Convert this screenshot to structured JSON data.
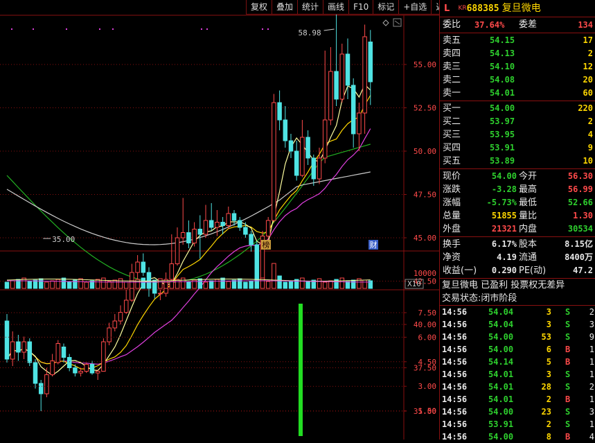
{
  "toolbar": {
    "items": [
      "复权",
      "叠加",
      "统计",
      "画线",
      "F10",
      "标记",
      "+自选",
      "返回"
    ]
  },
  "stock": {
    "marker": "L",
    "badge": "KR",
    "code": "688385",
    "name": "复旦微电"
  },
  "price_axis": [
    "55.00",
    "52.50",
    "50.00",
    "47.50",
    "45.00",
    "42.50",
    "40.00",
    "37.50",
    "35.00"
  ],
  "high_annotation": "58.98",
  "low_annotation": "35.00",
  "chart_tags": {
    "bang": "榜",
    "cai": "财"
  },
  "volume_axis": {
    "label": "10000",
    "multiplier": "X10"
  },
  "lower_axis": [
    "7.50",
    "6.00",
    "4.50",
    "3.00",
    "1.50"
  ],
  "order_book": {
    "weibi_label": "委比",
    "weibi_value": "37.64%",
    "weicha_label": "委差",
    "weicha_value": "134",
    "sell": [
      {
        "label": "卖五",
        "price": "54.15",
        "vol": "17"
      },
      {
        "label": "卖四",
        "price": "54.13",
        "vol": "2"
      },
      {
        "label": "卖三",
        "price": "54.10",
        "vol": "12"
      },
      {
        "label": "卖二",
        "price": "54.08",
        "vol": "20"
      },
      {
        "label": "卖一",
        "price": "54.01",
        "vol": "60"
      }
    ],
    "buy": [
      {
        "label": "买一",
        "price": "54.00",
        "vol": "220"
      },
      {
        "label": "买二",
        "price": "53.97",
        "vol": "2"
      },
      {
        "label": "买三",
        "price": "53.95",
        "vol": "4"
      },
      {
        "label": "买四",
        "price": "53.91",
        "vol": "9"
      },
      {
        "label": "买五",
        "price": "53.89",
        "vol": "10"
      }
    ]
  },
  "quote": [
    {
      "l1": "现价",
      "v1": "54.00",
      "c1": "green",
      "l2": "今开",
      "v2": "56.30",
      "c2": "red"
    },
    {
      "l1": "涨跌",
      "v1": "-3.28",
      "c1": "green",
      "l2": "最高",
      "v2": "56.99",
      "c2": "red"
    },
    {
      "l1": "涨幅",
      "v1": "-5.73%",
      "c1": "green",
      "l2": "最低",
      "v2": "52.66",
      "c2": "green"
    },
    {
      "l1": "总量",
      "v1": "51855",
      "c1": "yellow",
      "l2": "量比",
      "v2": "1.30",
      "c2": "red"
    },
    {
      "l1": "外盘",
      "v1": "21321",
      "c1": "red",
      "l2": "内盘",
      "v2": "30534",
      "c2": "green"
    }
  ],
  "fundamentals": [
    {
      "l1": "换手",
      "v1": "6.17%",
      "l2": "股本",
      "v2": "8.15亿"
    },
    {
      "l1": "净资",
      "v1": "4.19",
      "l2": "流通",
      "v2": "8400万"
    },
    {
      "l1": "收益(一)",
      "v1": "0.290",
      "l2": "PE(动)",
      "v2": "47.2"
    }
  ],
  "info": {
    "line1": "复旦微电 已盈利 投票权无差异",
    "line2": "交易状态:闭市阶段"
  },
  "ticks": [
    {
      "time": "14:56",
      "price": "54.04",
      "vol": "3",
      "side": "S",
      "n": "2"
    },
    {
      "time": "14:56",
      "price": "54.04",
      "vol": "3",
      "side": "S",
      "n": "3"
    },
    {
      "time": "14:56",
      "price": "54.00",
      "vol": "53",
      "side": "S",
      "n": "9"
    },
    {
      "time": "14:56",
      "price": "54.00",
      "vol": "6",
      "side": "B",
      "n": "1"
    },
    {
      "time": "14:56",
      "price": "54.14",
      "vol": "5",
      "side": "B",
      "n": "1"
    },
    {
      "time": "14:56",
      "price": "54.01",
      "vol": "3",
      "side": "S",
      "n": "1"
    },
    {
      "time": "14:56",
      "price": "54.01",
      "vol": "28",
      "side": "S",
      "n": "2"
    },
    {
      "time": "14:56",
      "price": "54.01",
      "vol": "2",
      "side": "B",
      "n": "1"
    },
    {
      "time": "14:56",
      "price": "54.00",
      "vol": "23",
      "side": "S",
      "n": "3"
    },
    {
      "time": "14:56",
      "price": "53.91",
      "vol": "2",
      "side": "S",
      "n": "1"
    },
    {
      "time": "14:56",
      "price": "54.00",
      "vol": "8",
      "side": "B",
      "n": "4"
    }
  ],
  "colors": {
    "up": "#ff4a4a",
    "down": "#4fe3e3",
    "grid": "#8a1010",
    "ma5": "#ffffa0",
    "ma10": "#ffd700",
    "ma20": "#e040e0",
    "ma60": "#cccccc",
    "ma120": "#22b022",
    "bar": "#22dd22"
  },
  "chart_data": {
    "type": "candlestick",
    "candles": [
      [
        40.2,
        38.0,
        40.6,
        37.8
      ],
      [
        38.0,
        39.0,
        39.6,
        37.6
      ],
      [
        39.0,
        38.4,
        39.4,
        37.9
      ],
      [
        38.4,
        39.0,
        39.3,
        38.0
      ],
      [
        39.0,
        37.8,
        39.2,
        37.6
      ],
      [
        37.8,
        36.6,
        38.0,
        36.3
      ],
      [
        36.6,
        36.0,
        36.8,
        35.0
      ],
      [
        36.0,
        37.1,
        37.5,
        35.8
      ],
      [
        37.1,
        37.9,
        38.3,
        37.0
      ],
      [
        37.8,
        38.9,
        39.1,
        37.7
      ],
      [
        38.7,
        38.1,
        38.9,
        37.8
      ],
      [
        38.1,
        37.5,
        38.3,
        37.3
      ],
      [
        37.5,
        37.2,
        37.7,
        37.0
      ],
      [
        37.2,
        37.3,
        37.5,
        37.0
      ],
      [
        37.3,
        37.7,
        37.8,
        37.2
      ],
      [
        37.7,
        37.2,
        37.9,
        37.1
      ],
      [
        37.2,
        37.3,
        37.4,
        36.8
      ],
      [
        37.3,
        39.0,
        39.2,
        37.3
      ],
      [
        39.0,
        39.8,
        40.1,
        38.8
      ],
      [
        39.8,
        40.2,
        40.6,
        39.6
      ],
      [
        40.2,
        40.7,
        41.1,
        40.0
      ],
      [
        40.7,
        41.4,
        42.0,
        40.6
      ],
      [
        41.4,
        43.0,
        43.5,
        41.3
      ],
      [
        43.0,
        43.6,
        44.0,
        42.3
      ],
      [
        43.6,
        43.0,
        44.1,
        42.8
      ],
      [
        43.0,
        42.1,
        43.3,
        41.6
      ],
      [
        42.1,
        41.8,
        42.3,
        41.5
      ],
      [
        41.8,
        41.8,
        42.0,
        41.4
      ],
      [
        41.8,
        42.6,
        43.0,
        41.6
      ],
      [
        42.6,
        43.5,
        45.2,
        42.4
      ],
      [
        43.5,
        45.0,
        45.6,
        43.4
      ],
      [
        45.0,
        45.3,
        47.3,
        44.6
      ],
      [
        45.3,
        44.7,
        46.0,
        44.4
      ],
      [
        44.7,
        45.5,
        45.9,
        44.5
      ],
      [
        45.5,
        45.2,
        46.3,
        43.8
      ],
      [
        45.2,
        46.0,
        46.9,
        45.0
      ],
      [
        46.0,
        45.6,
        47.0,
        45.4
      ],
      [
        45.6,
        45.9,
        46.6,
        45.1
      ],
      [
        45.9,
        45.7,
        46.2,
        45.2
      ],
      [
        45.7,
        46.4,
        46.8,
        45.5
      ],
      [
        46.4,
        46.0,
        46.6,
        45.7
      ],
      [
        46.0,
        45.6,
        46.2,
        45.4
      ],
      [
        45.6,
        45.2,
        45.9,
        45.0
      ],
      [
        45.2,
        44.6,
        45.4,
        44.2
      ],
      [
        44.6,
        42.6,
        44.8,
        42.5
      ],
      [
        42.6,
        45.1,
        45.4,
        42.6
      ],
      [
        45.1,
        46.0,
        46.2,
        44.9
      ],
      [
        46.0,
        52.8,
        53.3,
        45.9
      ],
      [
        52.8,
        51.8,
        53.5,
        51.2
      ],
      [
        51.8,
        50.6,
        52.6,
        50.2
      ],
      [
        50.6,
        50.0,
        51.0,
        49.6
      ],
      [
        50.0,
        48.6,
        50.6,
        48.3
      ],
      [
        48.6,
        50.8,
        51.8,
        48.5
      ],
      [
        50.8,
        49.6,
        51.2,
        49.2
      ],
      [
        49.6,
        48.4,
        49.8,
        48.0
      ],
      [
        48.4,
        49.6,
        50.2,
        48.1
      ],
      [
        49.6,
        51.8,
        55.8,
        49.3
      ],
      [
        51.8,
        54.6,
        56.0,
        51.5
      ],
      [
        54.6,
        53.0,
        58.98,
        52.6
      ],
      [
        53.0,
        55.6,
        56.2,
        52.8
      ],
      [
        55.6,
        53.8,
        56.5,
        53.0
      ],
      [
        53.8,
        51.0,
        54.2,
        50.2
      ],
      [
        51.0,
        52.2,
        52.8,
        50.0
      ],
      [
        52.2,
        56.6,
        57.3,
        51.0
      ],
      [
        56.3,
        54.0,
        56.99,
        52.66
      ]
    ]
  }
}
